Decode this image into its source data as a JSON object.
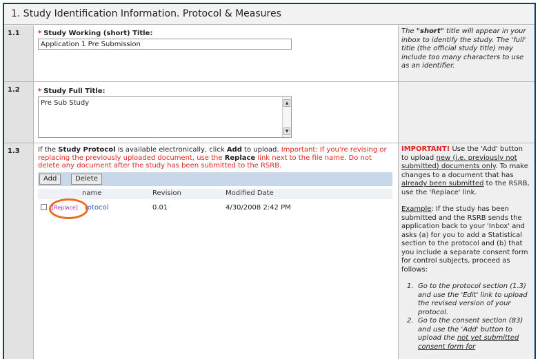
{
  "section": {
    "title": "1. Study Identification Information. Protocol & Measures"
  },
  "row1": {
    "number": "1.1",
    "label": "Study Working (short) Title:",
    "required_mark": "*",
    "value": "Application 1 Pre Submission",
    "help_parts": {
      "p1": "The ",
      "bold": "\"short\"",
      "p2": " title will appear in your inbox to identify the study.   The 'full' title (the official study title) may include too many characters to use as an identifier."
    }
  },
  "row2": {
    "number": "1.2",
    "label": "Study Full Title:",
    "required_mark": "*",
    "value": "Pre Sub Study",
    "scroll_up": "▲",
    "scroll_down": "▼"
  },
  "row3": {
    "number": "1.3",
    "intro": {
      "t1": "If the ",
      "b1": "Study Protocol",
      "t2": " is available electronically, click ",
      "b2": "Add",
      "t3": " to upload. ",
      "r1": "Important: If you're revising or replacing the previously uploaded document, use the ",
      "b3": "Replace",
      "r2": " link next to the file name.  Do not delete any document after the study has been submitted to the RSRB."
    },
    "buttons": {
      "add": "Add",
      "delete": "Delete"
    },
    "columns": {
      "name": "name",
      "revision": "Revision",
      "modified": "Modified Date"
    },
    "document": {
      "replace": "[Replace]",
      "name": "rotocol",
      "revision": "0.01",
      "modified": "4/30/2008 2:42 PM"
    },
    "help": {
      "important": "IMPORTANT!",
      "h1": " Use the 'Add' button to upload ",
      "u1": "new (i.e. previously not submitted) documents only",
      "h2": ".  To make changes to a document that has ",
      "u2": "already been submitted",
      "h3": " to the RSRB, use the 'Replace' link.",
      "example_label": "Example",
      "example": ": If the study has been submitted and the RSRB sends the application back to your 'Inbox' and asks (a) for you to add a Statistical section to the protocol and (b) that you include a separate consent form for control subjects, proceed as follows:",
      "step1_num": "1.",
      "step1": "Go to the protocol section (1.3) and use the 'Edit' link to upload the revised version of your protocol.",
      "step2_num": "2.",
      "step2a": "Go to the consent section (83) and use the 'Add' button to upload the ",
      "step2u": "not yet submitted consent form for"
    }
  }
}
